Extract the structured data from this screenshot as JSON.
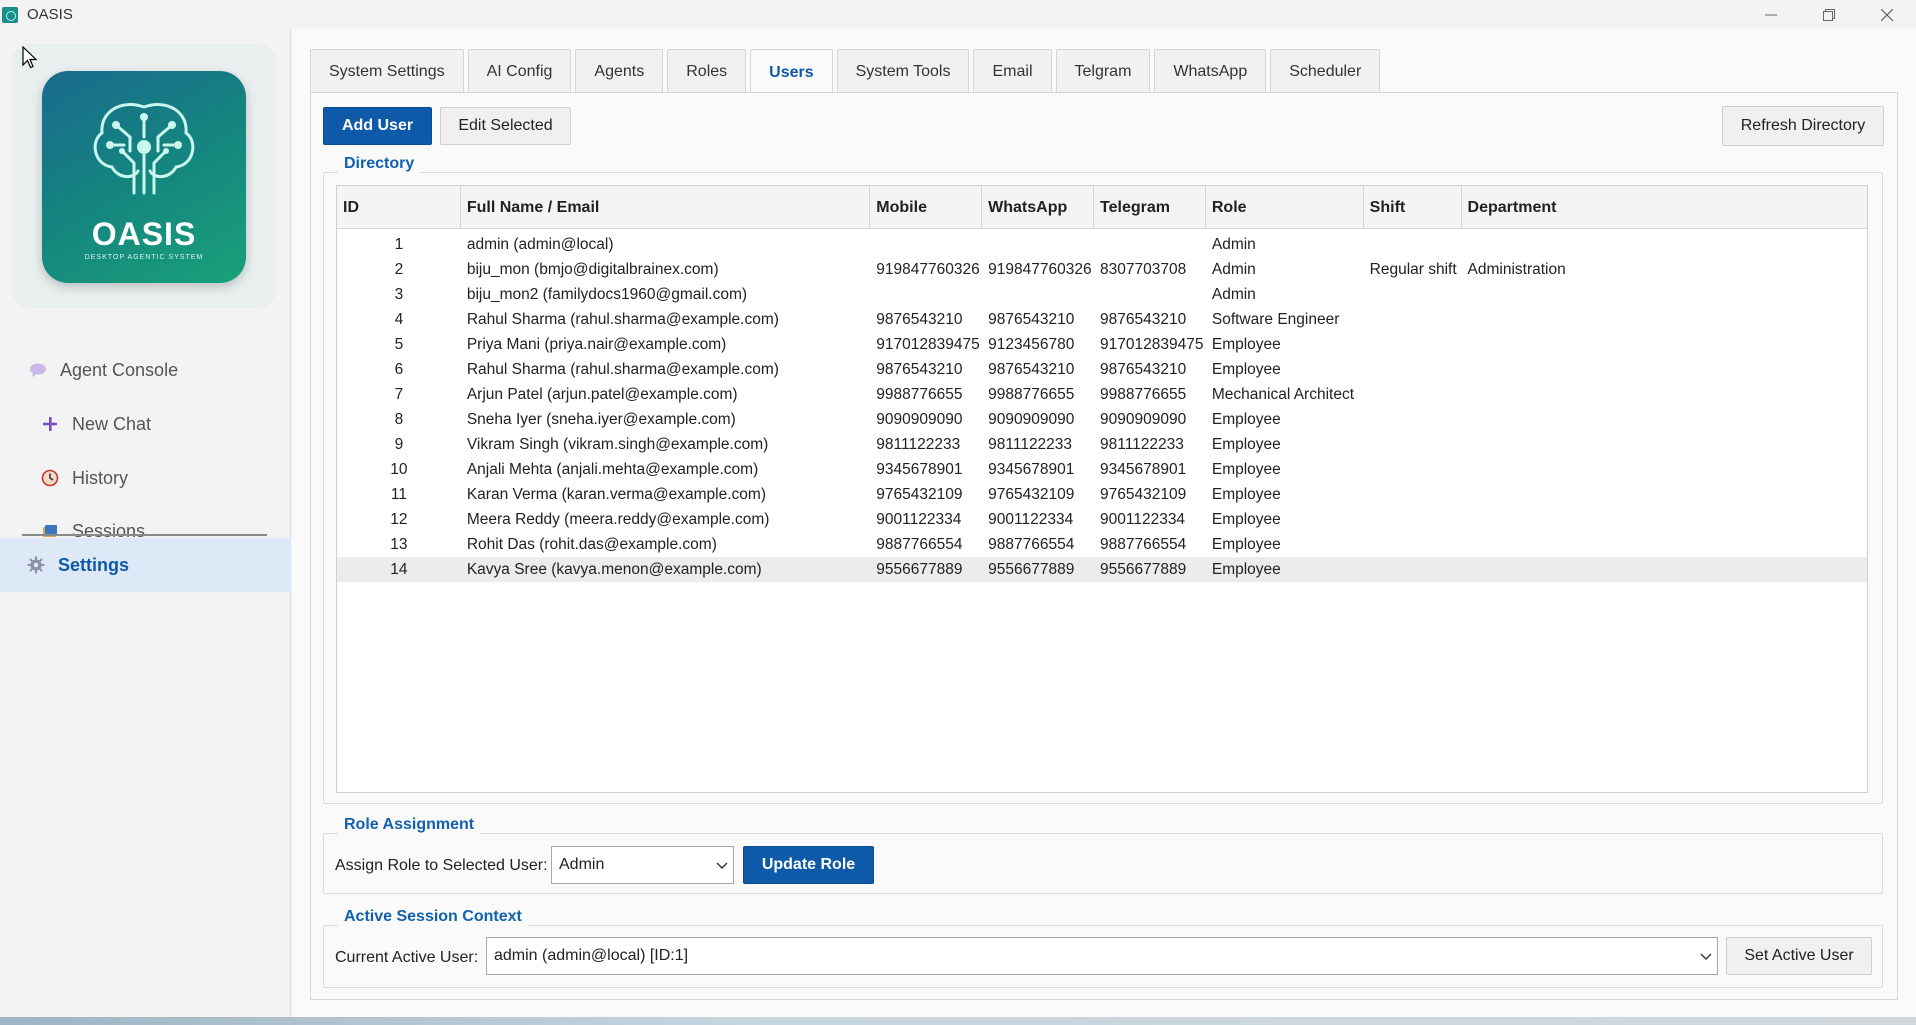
{
  "window": {
    "title": "OASIS",
    "controls": [
      "minimize-icon",
      "restore-icon",
      "close-icon"
    ]
  },
  "logo": {
    "name": "OASIS",
    "tagline": "DESKTOP AGENTIC SYSTEM"
  },
  "sidebar": {
    "items": [
      {
        "label": "Agent Console",
        "icon": "speech-bubble-icon"
      },
      {
        "label": "New Chat",
        "icon": "plus-icon"
      },
      {
        "label": "History",
        "icon": "clock-icon"
      },
      {
        "label": "Sessions",
        "icon": "sessions-icon"
      },
      {
        "label": "Settings",
        "icon": "gear-icon"
      }
    ]
  },
  "tabs": [
    "System Settings",
    "AI Config",
    "Agents",
    "Roles",
    "Users",
    "System Tools",
    "Email",
    "Telgram",
    "WhatsApp",
    "Scheduler"
  ],
  "active_tab": "Users",
  "toolbar": {
    "add_user": "Add User",
    "edit_selected": "Edit Selected",
    "refresh": "Refresh Directory"
  },
  "directory": {
    "title": "Directory",
    "columns": [
      "ID",
      "Full Name / Email",
      "Mobile",
      "WhatsApp",
      "Telegram",
      "Role",
      "Shift",
      "Department"
    ],
    "rows": [
      [
        "1",
        "admin (admin@local)",
        "",
        "",
        "",
        "Admin",
        "",
        ""
      ],
      [
        "2",
        "biju_mon (bmjo@digitalbrainex.com)",
        "919847760326",
        "919847760326",
        "8307703708",
        "Admin",
        "Regular shift",
        "Administration"
      ],
      [
        "3",
        "biju_mon2 (familydocs1960@gmail.com)",
        "",
        "",
        "",
        "Admin",
        "",
        ""
      ],
      [
        "4",
        "Rahul Sharma (rahul.sharma@example.com)",
        "9876543210",
        "9876543210",
        "9876543210",
        "Software Engineer",
        "",
        ""
      ],
      [
        "5",
        "Priya Mani (priya.nair@example.com)",
        "917012839475",
        "9123456780",
        "917012839475",
        "Employee",
        "",
        ""
      ],
      [
        "6",
        "Rahul Sharma (rahul.sharma@example.com)",
        "9876543210",
        "9876543210",
        "9876543210",
        "Employee",
        "",
        ""
      ],
      [
        "7",
        "Arjun Patel (arjun.patel@example.com)",
        "9988776655",
        "9988776655",
        "9988776655",
        "Mechanical Architect",
        "",
        ""
      ],
      [
        "8",
        "Sneha Iyer (sneha.iyer@example.com)",
        "9090909090",
        "9090909090",
        "9090909090",
        "Employee",
        "",
        ""
      ],
      [
        "9",
        "Vikram Singh (vikram.singh@example.com)",
        "9811122233",
        "9811122233",
        "9811122233",
        "Employee",
        "",
        ""
      ],
      [
        "10",
        "Anjali Mehta (anjali.mehta@example.com)",
        "9345678901",
        "9345678901",
        "9345678901",
        "Employee",
        "",
        ""
      ],
      [
        "11",
        "Karan Verma (karan.verma@example.com)",
        "9765432109",
        "9765432109",
        "9765432109",
        "Employee",
        "",
        ""
      ],
      [
        "12",
        "Meera Reddy (meera.reddy@example.com)",
        "9001122334",
        "9001122334",
        "9001122334",
        "Employee",
        "",
        ""
      ],
      [
        "13",
        "Rohit Das (rohit.das@example.com)",
        "9887766554",
        "9887766554",
        "9887766554",
        "Employee",
        "",
        ""
      ],
      [
        "14",
        "Kavya Sree (kavya.menon@example.com)",
        "9556677889",
        "9556677889",
        "9556677889",
        "Employee",
        "",
        ""
      ]
    ],
    "selected_row": 13
  },
  "role_assignment": {
    "title": "Role Assignment",
    "label": "Assign Role to Selected User:",
    "selected_role": "Admin",
    "update_button": "Update Role"
  },
  "session_context": {
    "title": "Active Session Context",
    "label": "Current Active User:",
    "selected_user": "admin (admin@local) [ID:1]",
    "set_button": "Set Active User"
  },
  "colors": {
    "accent": "#0f5aa8",
    "group_title": "#1061b0",
    "nav_active_bg": "#dde9f6"
  }
}
